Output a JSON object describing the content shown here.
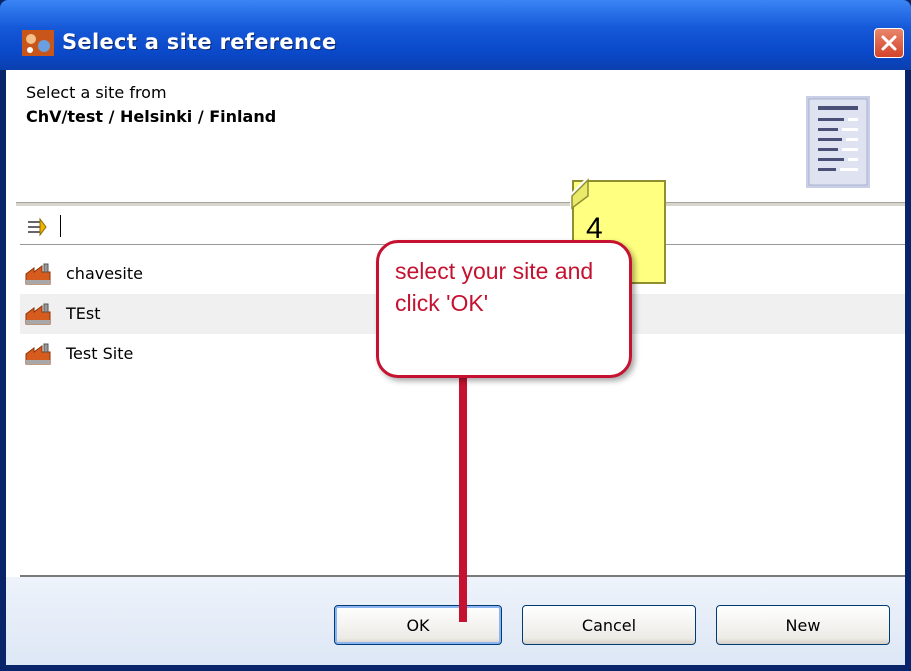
{
  "window": {
    "title": "Select a site reference",
    "title_icon": "app-logo-icon",
    "close_icon": "close-icon"
  },
  "header": {
    "label": "Select a site from",
    "path": "ChV/test  /  Helsinki  /  Finland",
    "illustration_icon": "document-list-icon"
  },
  "filter": {
    "icon": "filter-icon",
    "value": ""
  },
  "sites": [
    {
      "label": "chavesite",
      "icon": "site-building-icon"
    },
    {
      "label": "TEst",
      "icon": "site-building-icon"
    },
    {
      "label": "Test Site",
      "icon": "site-building-icon"
    }
  ],
  "buttons": {
    "ok": "OK",
    "cancel": "Cancel",
    "new": "New"
  },
  "annotation": {
    "step": "4",
    "text": "select your site and click 'OK'"
  },
  "colors": {
    "title_bar": "#0a49c9",
    "annotation_red": "#c41230",
    "note_yellow": "#ffff80"
  }
}
